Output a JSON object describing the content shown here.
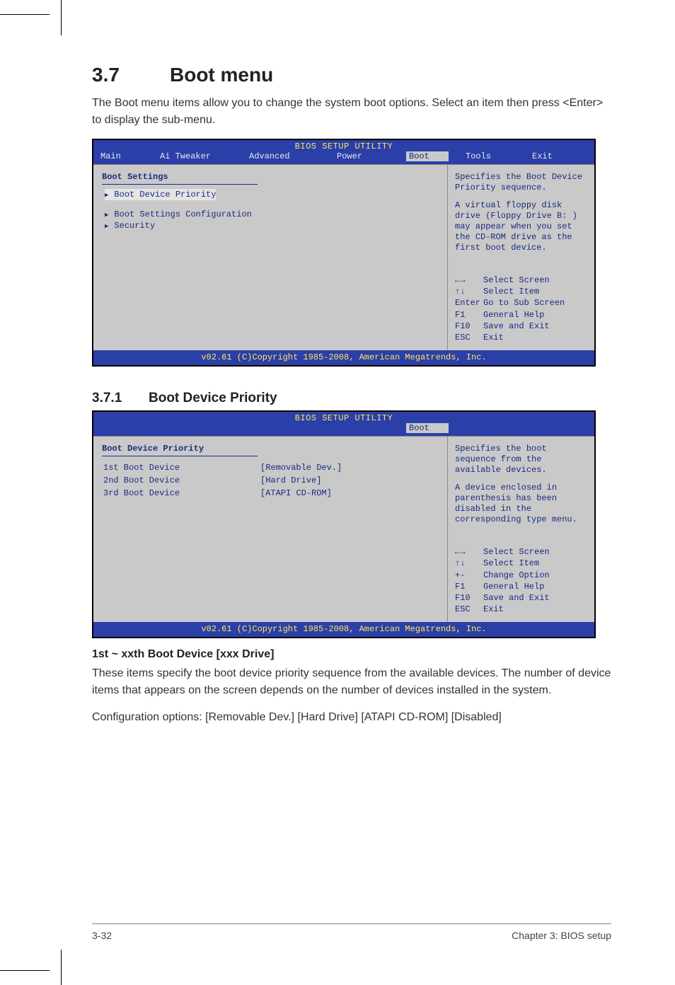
{
  "section": {
    "num": "3.7",
    "title": "Boot menu"
  },
  "intro": "The Boot menu items allow you to change the system boot options. Select an item then press <Enter> to display the sub-menu.",
  "bios1": {
    "title": "BIOS SETUP UTILITY",
    "tabs": {
      "main": "Main",
      "ai": "Ai Tweaker",
      "adv": "Advanced",
      "power": "Power",
      "boot": "Boot",
      "tools": "Tools",
      "exit": "Exit"
    },
    "heading": "Boot Settings",
    "items": {
      "i1": "Boot Device Priority",
      "i2": "Boot Settings Configuration",
      "i3": "Security"
    },
    "help1": "Specifies the Boot Device Priority sequence.",
    "help2": "A virtual floppy disk drive (Floppy Drive B: ) may appear when you set the CD-ROM drive as the first boot device.",
    "keys": {
      "k1": "Select Screen",
      "k2": "Select Item",
      "k3l": "Enter",
      "k3": "Go to Sub Screen",
      "k4l": "F1",
      "k4": "General Help",
      "k5l": "F10",
      "k5": "Save and Exit",
      "k6l": "ESC",
      "k6": "Exit"
    },
    "footer": "v02.61 (C)Copyright 1985-2008, American Megatrends, Inc."
  },
  "sub": {
    "num": "3.7.1",
    "title": "Boot Device Priority"
  },
  "bios2": {
    "title": "BIOS SETUP UTILITY",
    "tab": "Boot",
    "heading": "Boot Device Priority",
    "rows": {
      "r1k": "1st Boot Device",
      "r1v": "[Removable Dev.]",
      "r2k": "2nd Boot Device",
      "r2v": "[Hard Drive]",
      "r3k": "3rd Boot Device",
      "r3v": "[ATAPI CD-ROM]"
    },
    "help1": "Specifies the boot sequence from the available devices.",
    "help2": "A device enclosed in parenthesis has been disabled in the corresponding type menu.",
    "keys": {
      "k1": "Select Screen",
      "k2": "Select Item",
      "k3l": "+-",
      "k3": "Change Option",
      "k4l": "F1",
      "k4": "General Help",
      "k5l": "F10",
      "k5": "Save and Exit",
      "k6l": "ESC",
      "k6": "Exit"
    },
    "footer": "v02.61 (C)Copyright 1985-2008, American Megatrends, Inc."
  },
  "para_heading": "1st ~ xxth Boot Device [xxx Drive]",
  "para1": "These items specify the boot device priority sequence from the available devices. The number of device items that appears on the screen depends on the number of devices installed in the system.",
  "para2": "Configuration options: [Removable Dev.] [Hard Drive] [ATAPI CD-ROM] [Disabled]",
  "footer": {
    "left": "3-32",
    "right": "Chapter 3: BIOS setup"
  }
}
